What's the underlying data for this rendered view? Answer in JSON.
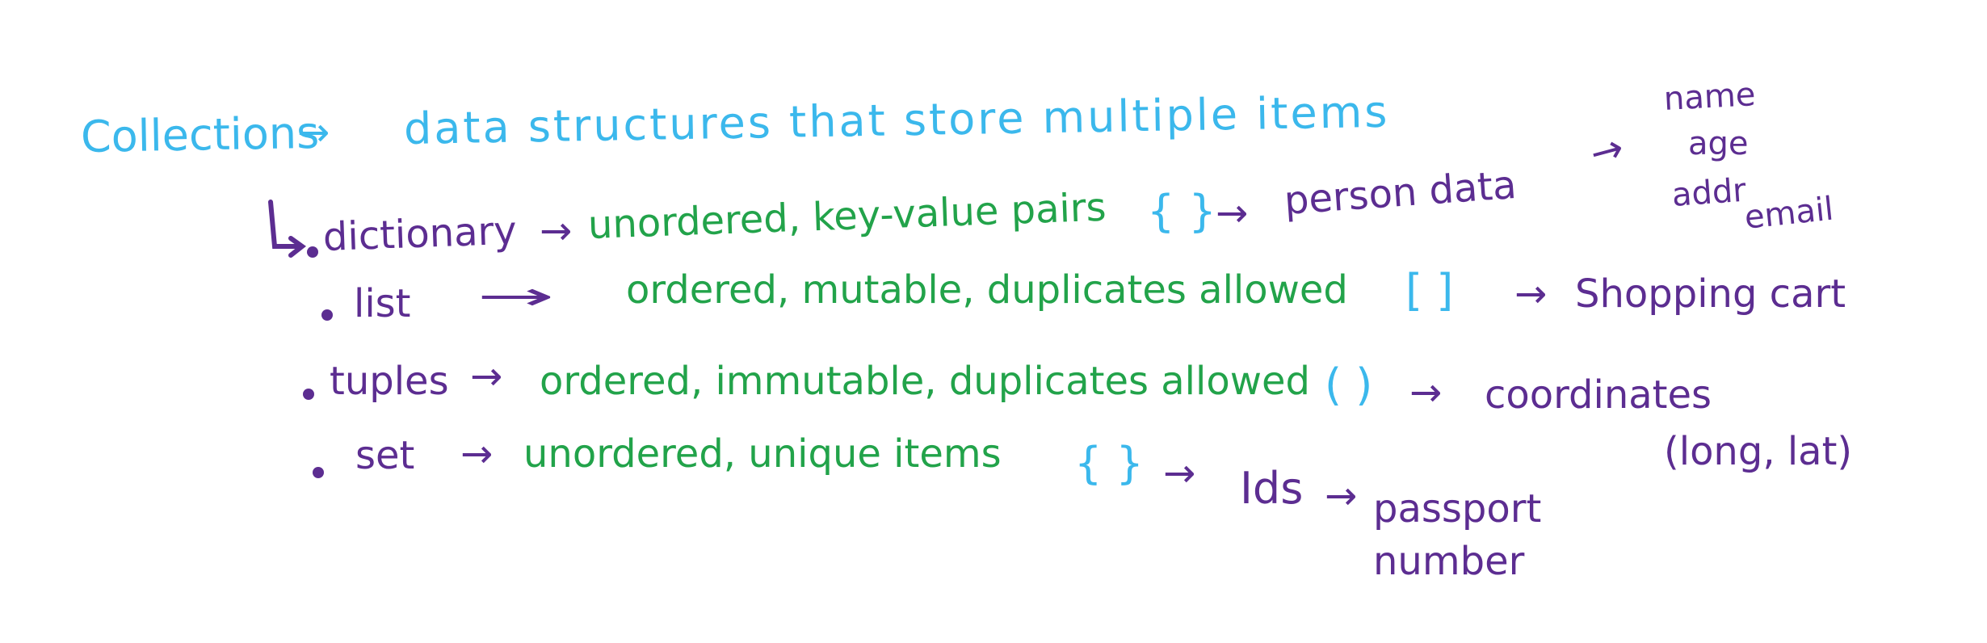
{
  "colors": {
    "heading": "#3bb8ec",
    "description": "#22a34a",
    "term": "#5c2d91",
    "background": "#ffffff"
  },
  "heading": {
    "term": "Collections",
    "definition": "data structures that store multiple items"
  },
  "arrow_glyph": "→",
  "items": [
    {
      "term": "dictionary",
      "description": "unordered, key-value pairs",
      "symbol": "{ }",
      "example": "person data",
      "fields": [
        "name",
        "age",
        "addr",
        "email"
      ]
    },
    {
      "term": "list",
      "description": "ordered, mutable, duplicates allowed",
      "symbol": "[ ]",
      "example": "Shopping cart"
    },
    {
      "term": "tuples",
      "description": "ordered, immutable, duplicates allowed",
      "symbol": "( )",
      "example": "coordinates",
      "note": "(long, lat)"
    },
    {
      "term": "set",
      "description": "unordered, unique items",
      "symbol": "{ }",
      "example": "Ids",
      "sub_example": "passport number"
    }
  ]
}
